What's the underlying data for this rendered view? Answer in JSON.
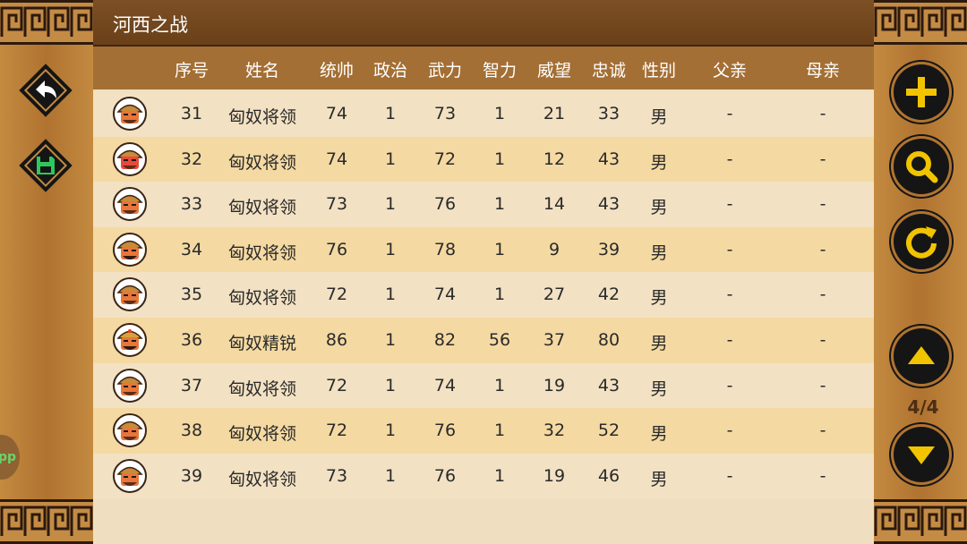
{
  "title": "河西之战",
  "columns": [
    "序号",
    "姓名",
    "统帅",
    "政治",
    "武力",
    "智力",
    "威望",
    "忠诚",
    "性别",
    "父亲",
    "母亲"
  ],
  "rows": [
    [
      "31",
      "匈奴将领",
      "74",
      "1",
      "73",
      "1",
      "21",
      "33",
      "男",
      "-",
      "-"
    ],
    [
      "32",
      "匈奴将领",
      "74",
      "1",
      "72",
      "1",
      "12",
      "43",
      "男",
      "-",
      "-"
    ],
    [
      "33",
      "匈奴将领",
      "73",
      "1",
      "76",
      "1",
      "14",
      "43",
      "男",
      "-",
      "-"
    ],
    [
      "34",
      "匈奴将领",
      "76",
      "1",
      "78",
      "1",
      "9",
      "39",
      "男",
      "-",
      "-"
    ],
    [
      "35",
      "匈奴将领",
      "72",
      "1",
      "74",
      "1",
      "27",
      "42",
      "男",
      "-",
      "-"
    ],
    [
      "36",
      "匈奴精锐",
      "86",
      "1",
      "82",
      "56",
      "37",
      "80",
      "男",
      "-",
      "-"
    ],
    [
      "37",
      "匈奴将领",
      "72",
      "1",
      "74",
      "1",
      "19",
      "43",
      "男",
      "-",
      "-"
    ],
    [
      "38",
      "匈奴将领",
      "72",
      "1",
      "76",
      "1",
      "32",
      "52",
      "男",
      "-",
      "-"
    ],
    [
      "39",
      "匈奴将领",
      "73",
      "1",
      "76",
      "1",
      "19",
      "46",
      "男",
      "-",
      "-"
    ]
  ],
  "avatar_icons": [
    "general-avatar-icon",
    "angry-general-avatar-icon",
    "general-avatar-icon",
    "bearded-general-avatar-icon",
    "general-avatar-icon",
    "elite-general-avatar-icon",
    "general-avatar-icon",
    "general-avatar-icon",
    "general-avatar-icon"
  ],
  "page_indicator": "4/4",
  "overlay_badge": "pp",
  "left_buttons": [
    "back-arrow-icon",
    "save-disk-icon"
  ],
  "right_buttons": [
    "plus-icon",
    "search-icon",
    "refresh-icon",
    "scroll-up-icon",
    "scroll-down-icon"
  ],
  "colors": {
    "title_bar": "#6e4219",
    "header": "#a46f34",
    "row_light": "#f2e1c3",
    "row_dark": "#f4d9a2",
    "side_wood": "#b5782e",
    "save_icon_green": "#2ec85a"
  }
}
